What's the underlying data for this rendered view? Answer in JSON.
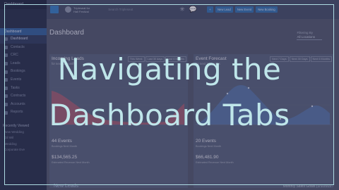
{
  "overlay": {
    "line1": "Navigating the",
    "line2": "Dashboard Tabs"
  },
  "sidebar": {
    "brand": "Dashboard",
    "section_title": "Dashboard",
    "items": [
      {
        "label": "Dashboard",
        "active": true
      },
      {
        "label": "Contacts",
        "active": false
      },
      {
        "label": "CRC",
        "active": false
      },
      {
        "label": "Leads",
        "active": false
      },
      {
        "label": "Bookings",
        "active": false
      },
      {
        "label": "Events",
        "active": false
      },
      {
        "label": "Tasks",
        "active": false
      },
      {
        "label": "Contracts",
        "active": false
      },
      {
        "label": "Accounts",
        "active": false
      },
      {
        "label": "Reports",
        "active": false
      }
    ],
    "recent_title": "Recently Viewed",
    "recent_items": [
      "New Wedding",
      "Gil Wil",
      "Wedding",
      "Corporate Eve"
    ]
  },
  "topbar": {
    "org_line1": "Tripleseat for",
    "org_line2": "Hall Festival",
    "search_placeholder": "Search Tripleseat",
    "buttons": [
      "New Lead",
      "New Event",
      "New Booking"
    ]
  },
  "main": {
    "page_title": "Dashboard",
    "filter_label": "Filtering By",
    "filter_value": "All Locations"
  },
  "left_panel": {
    "title": "Incoming Leads",
    "subtitle": "for next 12 months",
    "tabs": [
      "This Week",
      "Last 30 days",
      "Last 6 Months"
    ],
    "stat1_value": "44 Events",
    "stat1_caption": "Bookings Next Month",
    "stat2_value": "$134,565.25",
    "stat2_caption": "Estimated Revenue Next Month"
  },
  "right_panel": {
    "title": "Event Forecast",
    "subtitle": "for next 12 months",
    "tabs": [
      "Next 7 Days",
      "Next 30 Days",
      "Next 6 Months"
    ],
    "stat1_value": "20 Events",
    "stat1_caption": "Bookings Next Month",
    "stat2_value": "$66,481.90",
    "stat2_caption": "Estimated Revenue Next Month"
  },
  "footer": {
    "left": "New Leads",
    "right": "Monthly Sales Goals (1/1/2019 -"
  },
  "colors": {
    "sidebar_bg": "#1f2b46",
    "accent_blue": "#2c6fb0",
    "leads_area": "#a95b6f",
    "forecast_area": "#5276a8",
    "overlay_text": "#bfe6ea"
  }
}
